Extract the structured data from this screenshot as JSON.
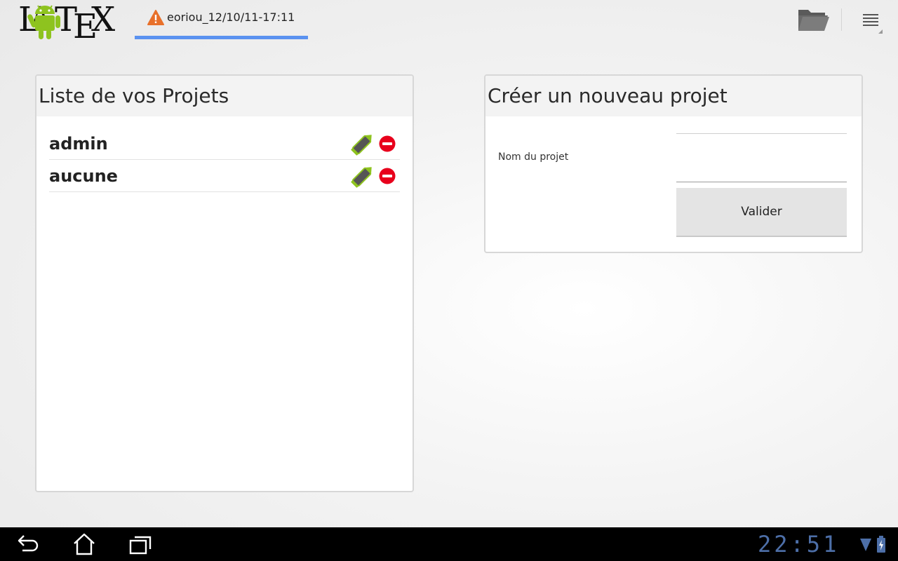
{
  "app": {
    "logo_text": "LaTeX"
  },
  "tab": {
    "label": "eoriou_12/10/11-17:11",
    "icon": "warning-icon"
  },
  "toolbar": {
    "folder_icon": "folder-open-icon",
    "menu_icon": "overflow-menu-icon"
  },
  "projects_panel": {
    "title": "Liste de vos Projets",
    "items": [
      {
        "name": "admin"
      },
      {
        "name": "aucune"
      }
    ]
  },
  "create_panel": {
    "title": "Créer un nouveau projet",
    "field_label": "Nom du projet",
    "field_value": "",
    "field_placeholder": "",
    "submit_label": "Valider"
  },
  "system_bar": {
    "time": "22:51",
    "icons": [
      "back-icon",
      "home-icon",
      "recent-apps-icon",
      "wifi-icon",
      "battery-icon"
    ]
  },
  "colors": {
    "tab_indicator": "#5b92f0",
    "warning": "#e8702a",
    "delete_red": "#e8001c",
    "pencil_green": "#8ec31f",
    "clock_blue": "#4d6fa8"
  }
}
